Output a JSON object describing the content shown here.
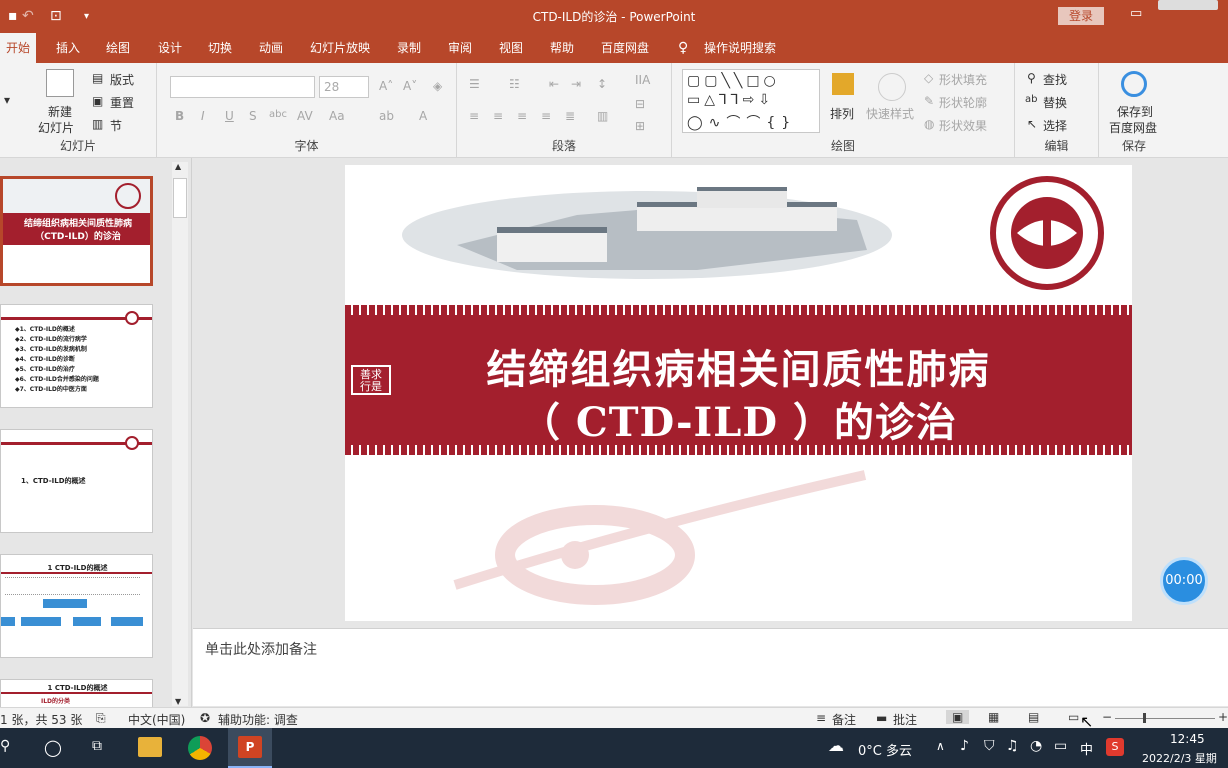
{
  "window": {
    "title": "CTD-ILD的诊治 - PowerPoint",
    "login": "登录"
  },
  "tabs": [
    "开始",
    "插入",
    "绘图",
    "设计",
    "切换",
    "动画",
    "幻灯片放映",
    "录制",
    "审阅",
    "视图",
    "帮助",
    "百度网盘"
  ],
  "tell_me": "操作说明搜索",
  "ribbon": {
    "slides_group": {
      "new_slide": "新建\n幻灯片",
      "new_line1": "新建",
      "new_line2": "幻灯片",
      "layout": "版式",
      "reset": "重置",
      "section": "节",
      "label": "幻灯片"
    },
    "font_group": {
      "font_size": "28",
      "label": "字体"
    },
    "paragraph_group": {
      "label": "段落"
    },
    "drawing_group": {
      "arrange": "排列",
      "quick_styles": "快速样式",
      "fill": "形状填充",
      "outline": "形状轮廓",
      "effects": "形状效果",
      "label": "绘图"
    },
    "editing_group": {
      "find": "查找",
      "replace": "替换",
      "select": "选择",
      "label": "编辑"
    },
    "save_group": {
      "save_line1": "保存到",
      "save_line2": "百度网盘",
      "label": "保存"
    }
  },
  "thumbnails": [
    {
      "title": "结缔组织病相关间质性肺病",
      "subtitle": "（CTD-ILD）的诊治"
    },
    {
      "items": [
        "◆1、CTD-ILD的概述",
        "◆2、CTD-ILD的流行病学",
        "◆3、CTD-ILD的发病机制",
        "◆4、CTD-ILD的诊断",
        "◆5、CTD-ILD的治疗",
        "◆6、CTD-ILD合并感染的问题",
        "◆7、CTD-ILD的中医方面"
      ]
    },
    {
      "text": "1、CTD-ILD的概述"
    },
    {
      "title": "1 CTD-ILD的概述"
    },
    {
      "title": "1 CTD-ILD的概述",
      "sub": "ILD的分类"
    }
  ],
  "slide": {
    "title_line1": "结缔组织病相关间质性肺病",
    "title_line2": "（ CTD-ILD ）的诊治",
    "seal": "善求\n行是",
    "seal_a": "善求",
    "seal_b": "行是"
  },
  "notes_placeholder": "单击此处添加备注",
  "timer": "00:00",
  "status": {
    "slide_info": "1 张，共 53 张",
    "language": "中文(中国)",
    "accessibility": "辅助功能: 调查",
    "notes": "备注",
    "comments": "批注"
  },
  "taskbar": {
    "weather": "0°C  多云",
    "ime": "中",
    "time": "12:45",
    "date": "2022/2/3 星期"
  }
}
